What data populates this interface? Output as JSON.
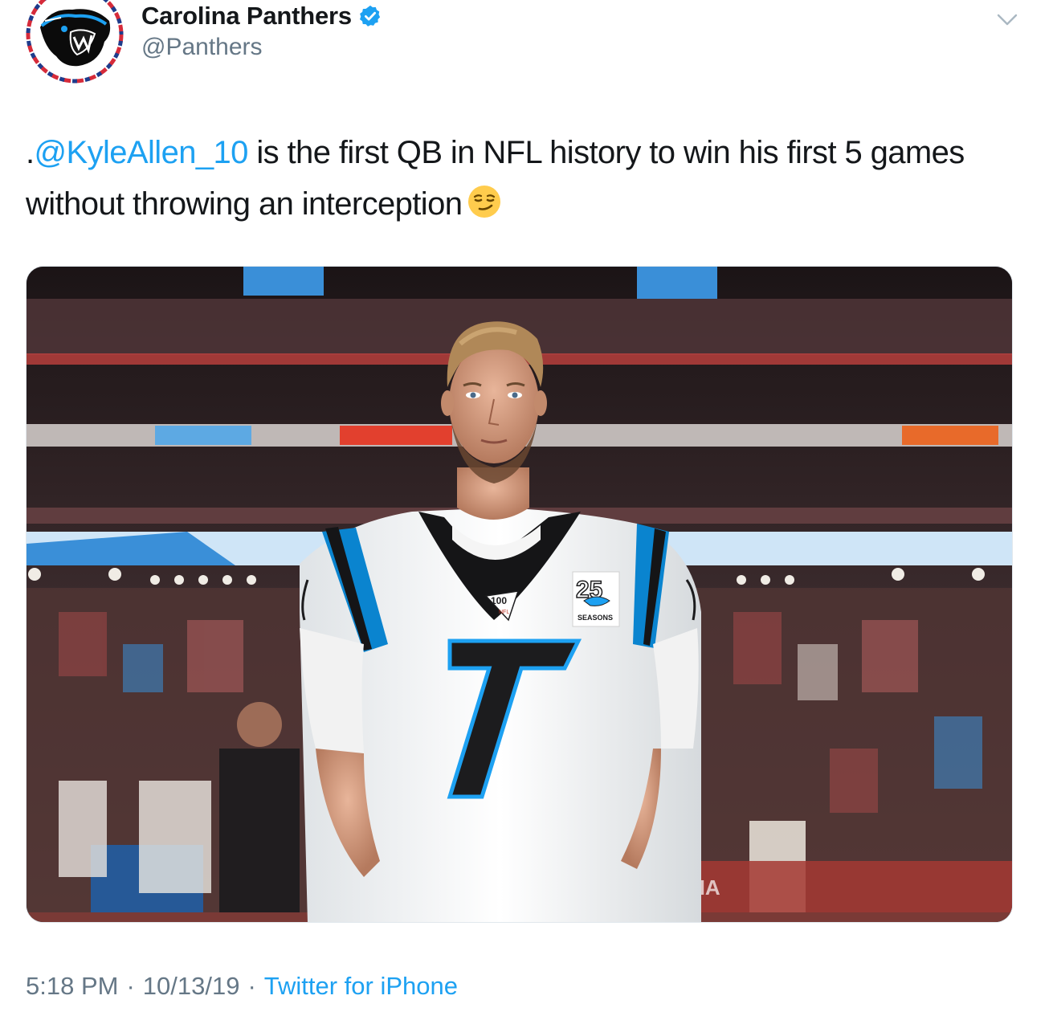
{
  "tweet": {
    "author": {
      "display_name": "Carolina Panthers",
      "handle": "@Panthers",
      "verified": true,
      "avatar_icon": "panthers-logo-icon"
    },
    "text_prefix": ".",
    "mention": "@KyleAllen_10",
    "text_body": " is the first QB in NFL history to win his first 5 games without throwing an interception",
    "emoji": "smirking-face",
    "media": {
      "jersey_number": "7",
      "patch_100": "100",
      "patch_100_sub": "NFL",
      "patch_25": "25",
      "patch_25_sub": "SEASONS",
      "banner_text": "ZONA"
    },
    "time": "5:18 PM",
    "date": "10/13/19",
    "separator": "·",
    "source": "Twitter for iPhone"
  },
  "colors": {
    "link": "#1da1f2",
    "muted": "#657786",
    "text": "#14171a",
    "panthers_blue": "#0085ca"
  },
  "icons": {
    "verified": "verified-badge-icon",
    "caret": "chevron-down-icon"
  }
}
